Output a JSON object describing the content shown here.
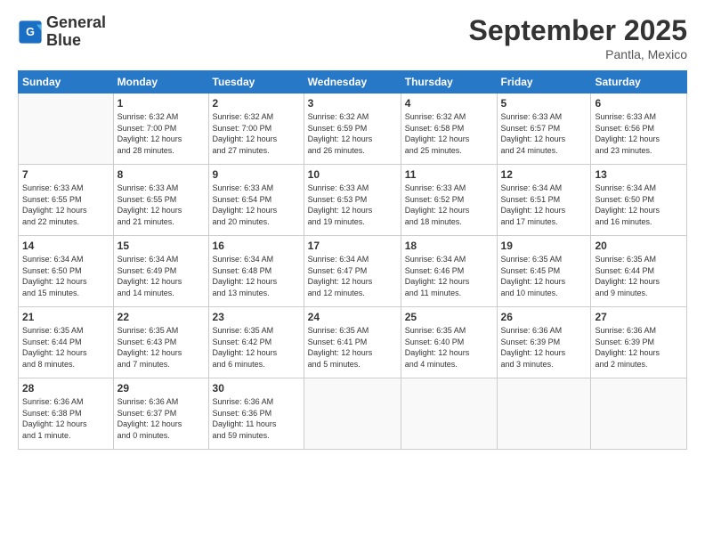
{
  "logo": {
    "line1": "General",
    "line2": "Blue"
  },
  "title": "September 2025",
  "subtitle": "Pantla, Mexico",
  "days_header": [
    "Sunday",
    "Monday",
    "Tuesday",
    "Wednesday",
    "Thursday",
    "Friday",
    "Saturday"
  ],
  "weeks": [
    [
      {
        "day": "",
        "info": ""
      },
      {
        "day": "1",
        "info": "Sunrise: 6:32 AM\nSunset: 7:00 PM\nDaylight: 12 hours\nand 28 minutes."
      },
      {
        "day": "2",
        "info": "Sunrise: 6:32 AM\nSunset: 7:00 PM\nDaylight: 12 hours\nand 27 minutes."
      },
      {
        "day": "3",
        "info": "Sunrise: 6:32 AM\nSunset: 6:59 PM\nDaylight: 12 hours\nand 26 minutes."
      },
      {
        "day": "4",
        "info": "Sunrise: 6:32 AM\nSunset: 6:58 PM\nDaylight: 12 hours\nand 25 minutes."
      },
      {
        "day": "5",
        "info": "Sunrise: 6:33 AM\nSunset: 6:57 PM\nDaylight: 12 hours\nand 24 minutes."
      },
      {
        "day": "6",
        "info": "Sunrise: 6:33 AM\nSunset: 6:56 PM\nDaylight: 12 hours\nand 23 minutes."
      }
    ],
    [
      {
        "day": "7",
        "info": "Sunrise: 6:33 AM\nSunset: 6:55 PM\nDaylight: 12 hours\nand 22 minutes."
      },
      {
        "day": "8",
        "info": "Sunrise: 6:33 AM\nSunset: 6:55 PM\nDaylight: 12 hours\nand 21 minutes."
      },
      {
        "day": "9",
        "info": "Sunrise: 6:33 AM\nSunset: 6:54 PM\nDaylight: 12 hours\nand 20 minutes."
      },
      {
        "day": "10",
        "info": "Sunrise: 6:33 AM\nSunset: 6:53 PM\nDaylight: 12 hours\nand 19 minutes."
      },
      {
        "day": "11",
        "info": "Sunrise: 6:33 AM\nSunset: 6:52 PM\nDaylight: 12 hours\nand 18 minutes."
      },
      {
        "day": "12",
        "info": "Sunrise: 6:34 AM\nSunset: 6:51 PM\nDaylight: 12 hours\nand 17 minutes."
      },
      {
        "day": "13",
        "info": "Sunrise: 6:34 AM\nSunset: 6:50 PM\nDaylight: 12 hours\nand 16 minutes."
      }
    ],
    [
      {
        "day": "14",
        "info": "Sunrise: 6:34 AM\nSunset: 6:50 PM\nDaylight: 12 hours\nand 15 minutes."
      },
      {
        "day": "15",
        "info": "Sunrise: 6:34 AM\nSunset: 6:49 PM\nDaylight: 12 hours\nand 14 minutes."
      },
      {
        "day": "16",
        "info": "Sunrise: 6:34 AM\nSunset: 6:48 PM\nDaylight: 12 hours\nand 13 minutes."
      },
      {
        "day": "17",
        "info": "Sunrise: 6:34 AM\nSunset: 6:47 PM\nDaylight: 12 hours\nand 12 minutes."
      },
      {
        "day": "18",
        "info": "Sunrise: 6:34 AM\nSunset: 6:46 PM\nDaylight: 12 hours\nand 11 minutes."
      },
      {
        "day": "19",
        "info": "Sunrise: 6:35 AM\nSunset: 6:45 PM\nDaylight: 12 hours\nand 10 minutes."
      },
      {
        "day": "20",
        "info": "Sunrise: 6:35 AM\nSunset: 6:44 PM\nDaylight: 12 hours\nand 9 minutes."
      }
    ],
    [
      {
        "day": "21",
        "info": "Sunrise: 6:35 AM\nSunset: 6:44 PM\nDaylight: 12 hours\nand 8 minutes."
      },
      {
        "day": "22",
        "info": "Sunrise: 6:35 AM\nSunset: 6:43 PM\nDaylight: 12 hours\nand 7 minutes."
      },
      {
        "day": "23",
        "info": "Sunrise: 6:35 AM\nSunset: 6:42 PM\nDaylight: 12 hours\nand 6 minutes."
      },
      {
        "day": "24",
        "info": "Sunrise: 6:35 AM\nSunset: 6:41 PM\nDaylight: 12 hours\nand 5 minutes."
      },
      {
        "day": "25",
        "info": "Sunrise: 6:35 AM\nSunset: 6:40 PM\nDaylight: 12 hours\nand 4 minutes."
      },
      {
        "day": "26",
        "info": "Sunrise: 6:36 AM\nSunset: 6:39 PM\nDaylight: 12 hours\nand 3 minutes."
      },
      {
        "day": "27",
        "info": "Sunrise: 6:36 AM\nSunset: 6:39 PM\nDaylight: 12 hours\nand 2 minutes."
      }
    ],
    [
      {
        "day": "28",
        "info": "Sunrise: 6:36 AM\nSunset: 6:38 PM\nDaylight: 12 hours\nand 1 minute."
      },
      {
        "day": "29",
        "info": "Sunrise: 6:36 AM\nSunset: 6:37 PM\nDaylight: 12 hours\nand 0 minutes."
      },
      {
        "day": "30",
        "info": "Sunrise: 6:36 AM\nSunset: 6:36 PM\nDaylight: 11 hours\nand 59 minutes."
      },
      {
        "day": "",
        "info": ""
      },
      {
        "day": "",
        "info": ""
      },
      {
        "day": "",
        "info": ""
      },
      {
        "day": "",
        "info": ""
      }
    ]
  ]
}
